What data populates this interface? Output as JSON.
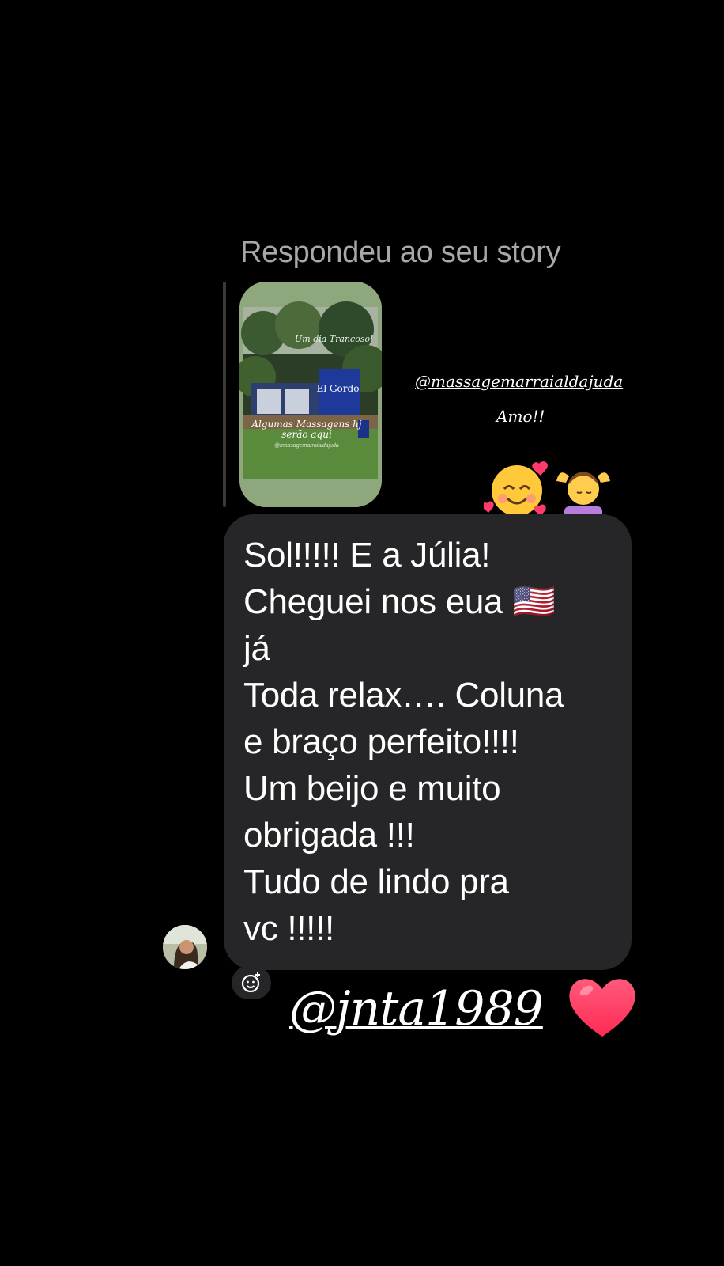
{
  "reply_header": "Respondeu ao seu story",
  "story": {
    "caption_top": "Um dia Trancoso!",
    "sign_text": "El Gordo",
    "caption_bottom": "Algumas Massagens hj serão aqui",
    "tag": "@massagemarraialdajuda"
  },
  "overlay": {
    "mention": "@massagemarraialdajuda",
    "amo": "Amo!!"
  },
  "reactions": [
    "smiling-face-with-hearts",
    "person-getting-massage"
  ],
  "message": {
    "lines": [
      "Sol!!!!! E a Júlia!",
      "Cheguei nos eua 🇺🇸",
      "já",
      "Toda relax…. Coluna",
      "e braço perfeito!!!!",
      "Um beijo e muito",
      "obrigada !!!",
      "Tudo de lindo pra",
      "vc !!!!!"
    ]
  },
  "username": "@jnta1989",
  "end_emoji": "red-heart",
  "colors": {
    "background": "#000000",
    "bubble": "#262628",
    "header_text": "#a8a8a8",
    "text": "#ffffff",
    "heart": "#ff2a55"
  }
}
